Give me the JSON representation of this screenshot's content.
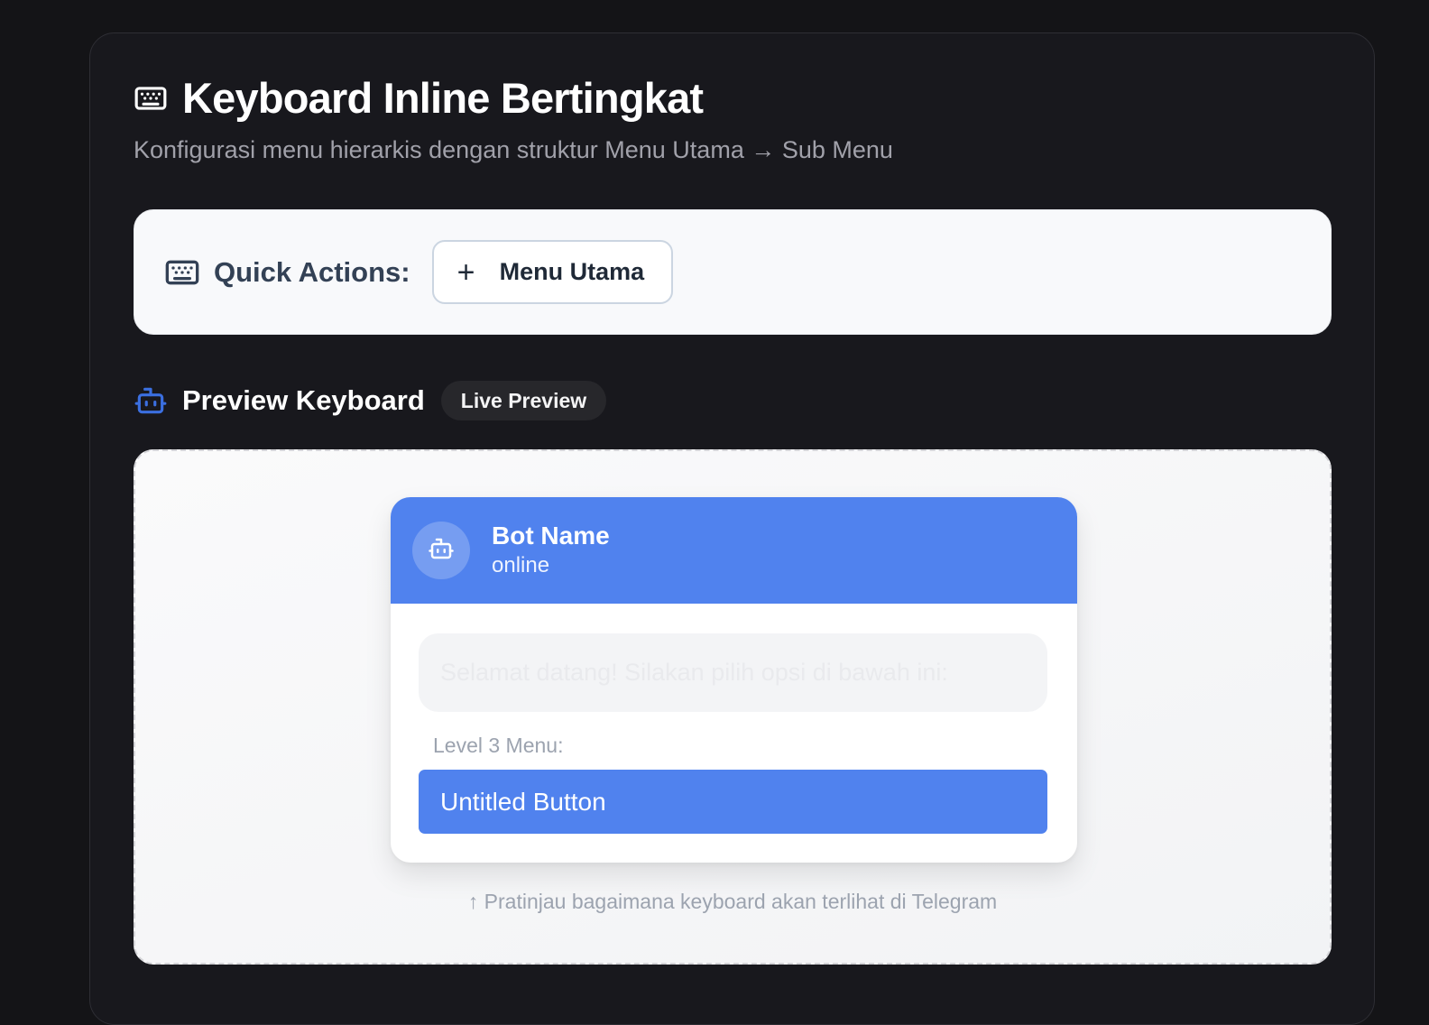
{
  "header": {
    "title": "Keyboard Inline Bertingkat",
    "subtitle": "Konfigurasi menu hierarkis dengan struktur Menu Utama → Sub Menu",
    "icon": "keyboard-icon"
  },
  "quick_actions": {
    "label": "Quick Actions:",
    "icon": "keyboard-icon",
    "add_menu_button": {
      "icon": "plus-icon",
      "plus_glyph": "+",
      "label": "Menu Utama"
    }
  },
  "preview": {
    "icon": "robot-icon",
    "title": "Preview Keyboard",
    "badge": "Live Preview",
    "caption": "↑ Pratinjau bagaimana keyboard akan terlihat di Telegram",
    "chat": {
      "bot_name": "Bot Name",
      "bot_status": "online",
      "message": "Selamat datang! Silakan pilih opsi di bawah ini:",
      "level_label": "Level 3 Menu:",
      "buttons": [
        {
          "label": "Untitled Button"
        }
      ]
    }
  },
  "colors": {
    "page_background": "#141417",
    "panel_background": "#18181d",
    "accent_blue": "#5082ee",
    "card_background": "#f8f9fb"
  }
}
